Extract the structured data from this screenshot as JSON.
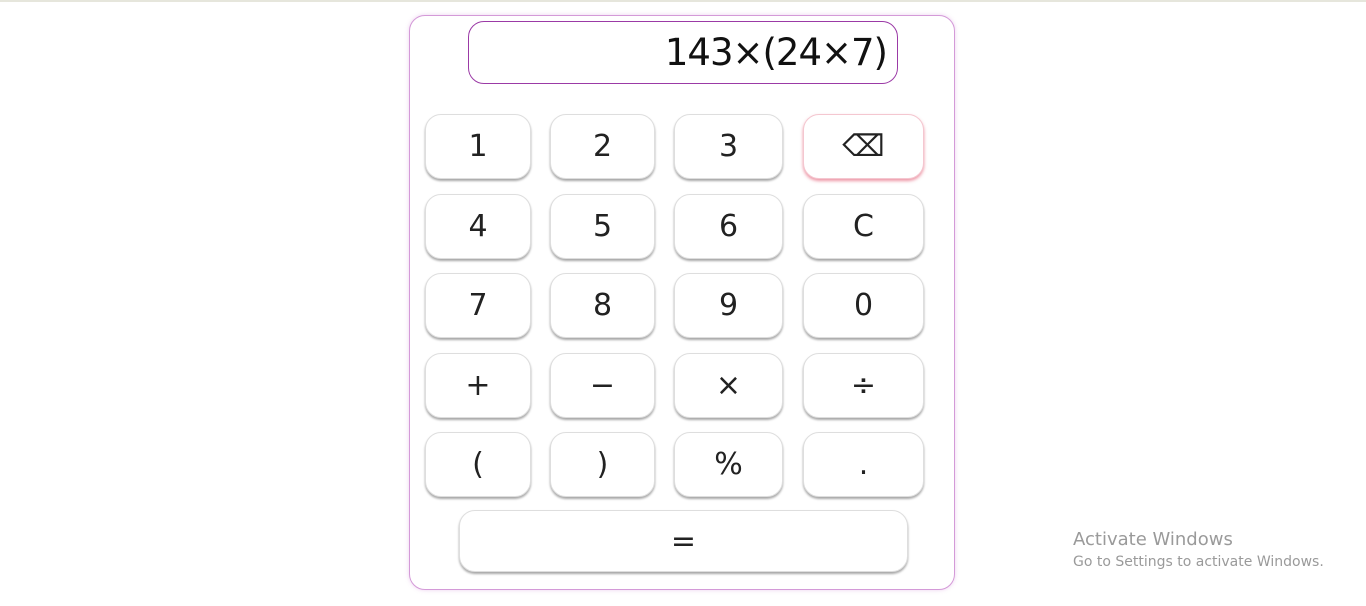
{
  "display": {
    "expression": "143×(24×7)"
  },
  "keys": {
    "k1": "1",
    "k2": "2",
    "k3": "3",
    "backspace": "⌫",
    "k4": "4",
    "k5": "5",
    "k6": "6",
    "clear": "C",
    "k7": "7",
    "k8": "8",
    "k9": "9",
    "k0": "0",
    "plus": "+",
    "minus": "−",
    "multiply": "×",
    "divide": "÷",
    "open_paren": "(",
    "close_paren": ")",
    "percent": "%",
    "decimal": ".",
    "equals": "="
  },
  "watermark": {
    "line1": "Activate Windows",
    "line2": "Go to Settings to activate Windows."
  },
  "colors": {
    "border_accent": "#d49ad8",
    "display_border": "#9b3aa6",
    "backspace_glow": "#dc3c5a"
  }
}
